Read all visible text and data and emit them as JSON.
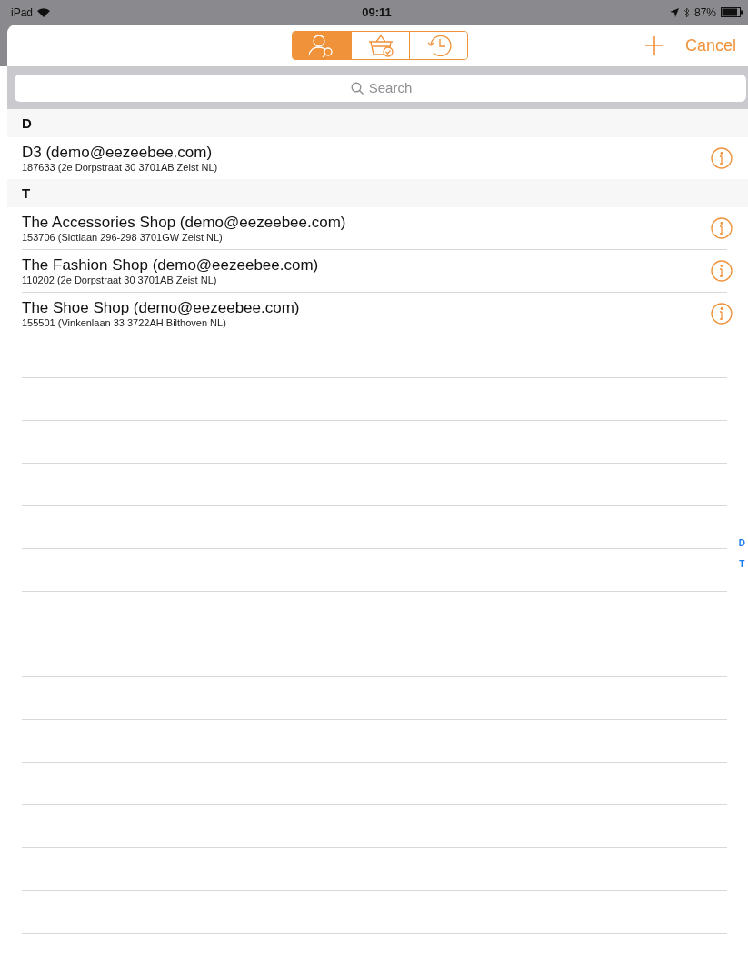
{
  "status_bar": {
    "carrier": "iPad",
    "time": "09:11",
    "battery": "87%"
  },
  "segments": [
    {
      "kind": "customer",
      "selected": true
    },
    {
      "kind": "basket",
      "selected": false
    },
    {
      "kind": "history",
      "selected": false
    }
  ],
  "nav": {
    "cancel": "Cancel"
  },
  "search": {
    "placeholder": "Search"
  },
  "sections": [
    {
      "letter": "D",
      "rows": [
        {
          "name": "D3 (demo@eezeebee.com)",
          "detail": "187633 (2e Dorpstraat 30 3701AB Zeist NL)"
        }
      ]
    },
    {
      "letter": "T",
      "rows": [
        {
          "name": "The Accessories Shop (demo@eezeebee.com)",
          "detail": "153706 (Slotlaan 296-298 3701GW Zeist NL)"
        },
        {
          "name": "The Fashion Shop (demo@eezeebee.com)",
          "detail": "110202 (2e Dorpstraat 30 3701AB Zeist NL)"
        },
        {
          "name": "The Shoe Shop (demo@eezeebee.com)",
          "detail": "155501 (Vinkenlaan 33 3722AH Bilthoven NL)"
        }
      ]
    }
  ],
  "index": [
    "D",
    "T"
  ]
}
